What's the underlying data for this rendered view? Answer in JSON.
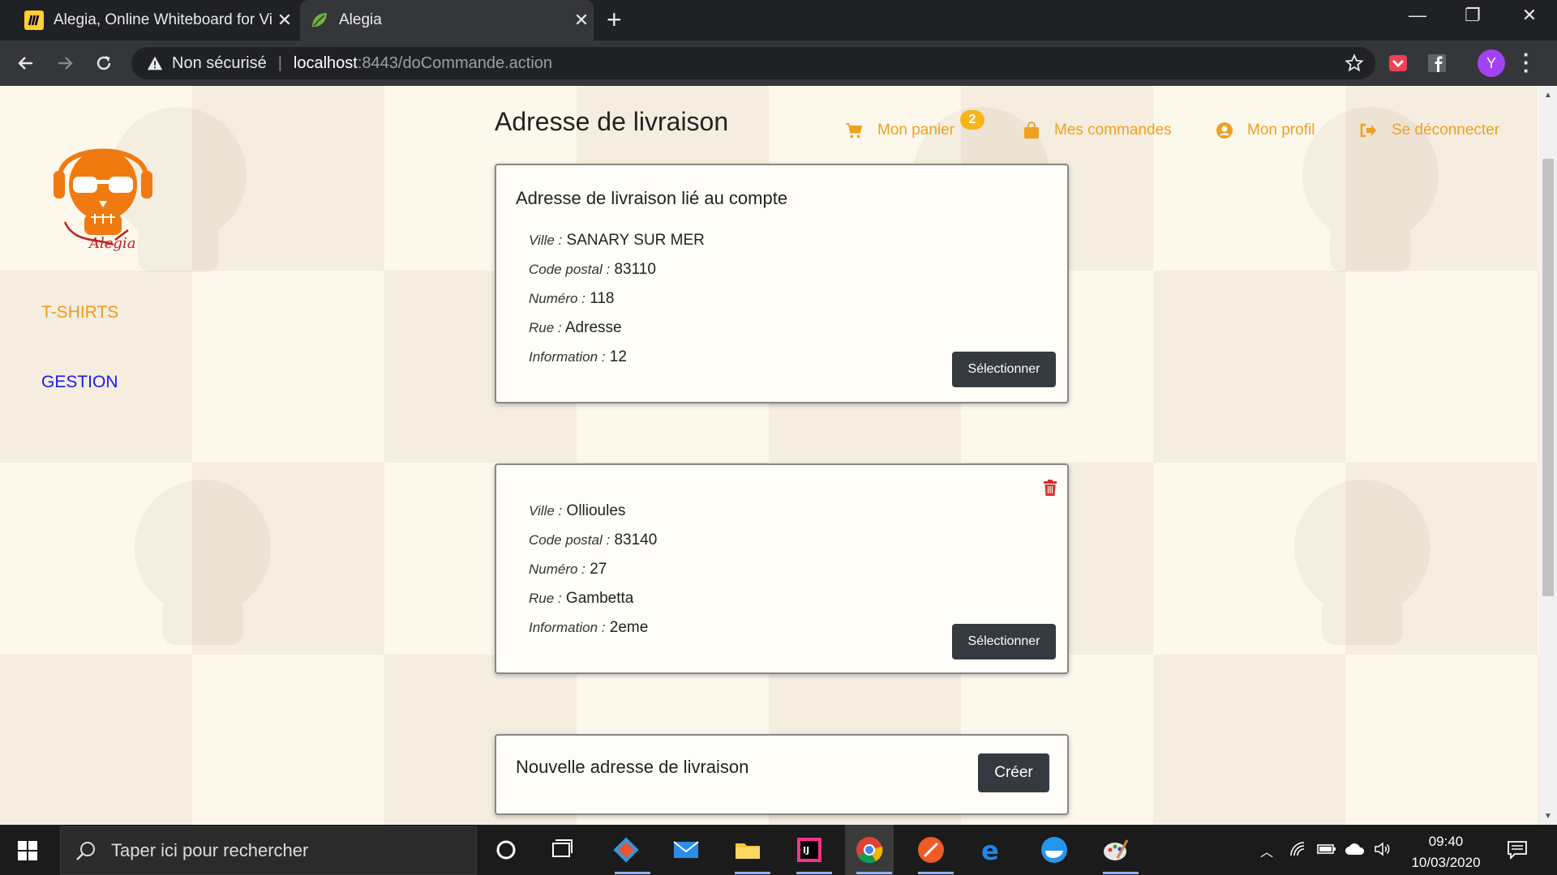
{
  "browser": {
    "tabs": [
      {
        "title": "Alegia, Online Whiteboard for Vi",
        "active": false,
        "icon": "miro-icon"
      },
      {
        "title": "Alegia",
        "active": true,
        "icon": "spring-leaf-icon"
      }
    ],
    "security_text": "Non sécurisé",
    "url_host": "localhost",
    "url_rest": ":8443/doCommande.action",
    "profile_initial": "Y"
  },
  "sidebar": {
    "items": [
      {
        "label": "T-SHIRTS",
        "color": "#f49a17"
      },
      {
        "label": "GESTION",
        "color": "#1a1ae6"
      }
    ]
  },
  "header": {
    "title": "Adresse de livraison",
    "nav": [
      {
        "label": "Mon panier",
        "icon": "cart-icon"
      },
      {
        "label": "Mes commandes",
        "icon": "bag-icon"
      },
      {
        "label": "Mon profil",
        "icon": "user-circle-icon"
      },
      {
        "label": "Se déconnecter",
        "icon": "sign-out-icon"
      }
    ],
    "cart_count": "2"
  },
  "cards": [
    {
      "title": "Adresse de livraison lié au compte",
      "fields": [
        {
          "label": "Ville :",
          "value": "SANARY SUR MER"
        },
        {
          "label": "Code postal :",
          "value": "83110"
        },
        {
          "label": "Numéro :",
          "value": "118"
        },
        {
          "label": "Rue :",
          "value": "Adresse"
        },
        {
          "label": "Information :",
          "value": "12"
        }
      ],
      "button": "Sélectionner"
    },
    {
      "title": "",
      "fields": [
        {
          "label": "Ville :",
          "value": "Ollioules"
        },
        {
          "label": "Code postal :",
          "value": "83140"
        },
        {
          "label": "Numéro :",
          "value": "27"
        },
        {
          "label": "Rue :",
          "value": "Gambetta"
        },
        {
          "label": "Information :",
          "value": "2eme"
        }
      ],
      "button": "Sélectionner"
    }
  ],
  "new_address": {
    "title": "Nouvelle adresse de livraison",
    "button": "Créer"
  },
  "taskbar": {
    "search_placeholder": "Taper ici pour rechercher",
    "time": "09:40",
    "date": "10/03/2020"
  },
  "colors": {
    "accent": "#f0a020",
    "button_dark": "#343a40",
    "delete": "#d9302c"
  }
}
